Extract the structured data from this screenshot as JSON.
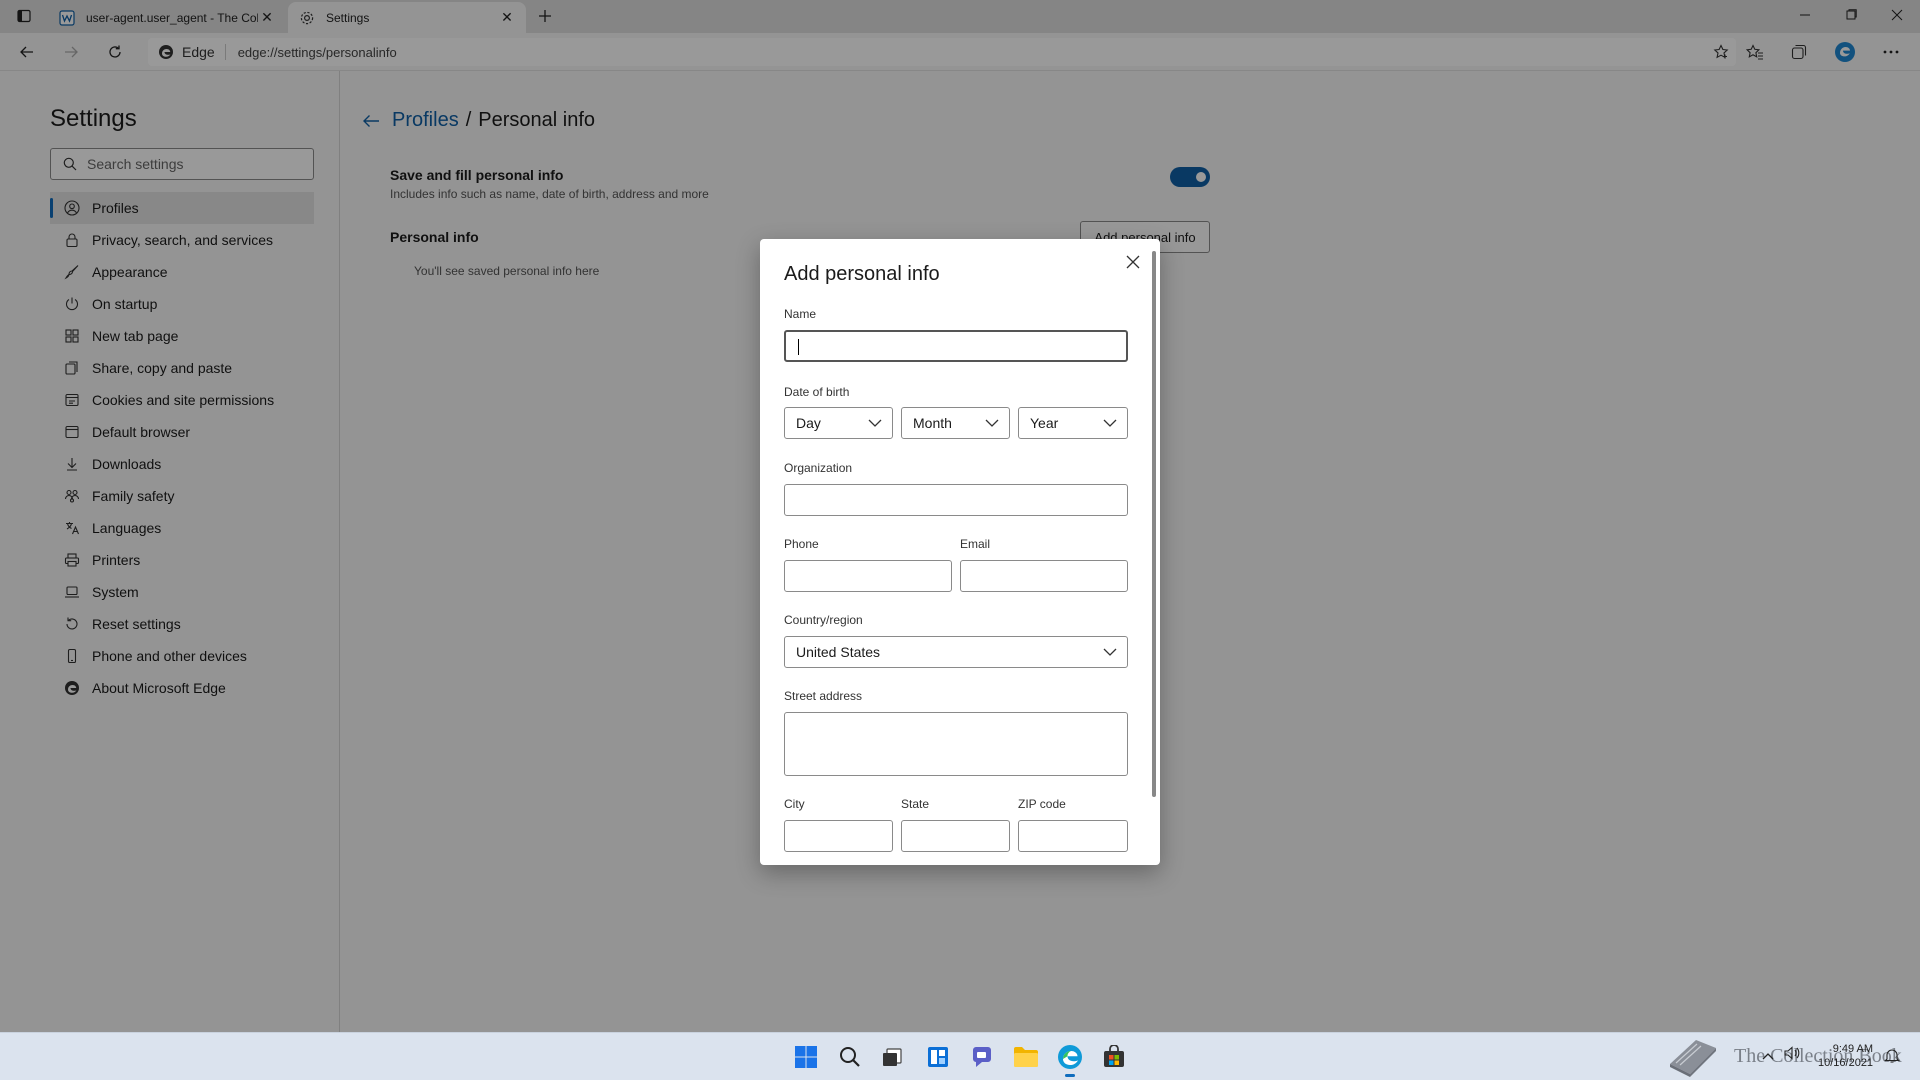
{
  "browser": {
    "tabs": [
      {
        "title": "user-agent.user_agent - The Coll",
        "icon": "document-favicon",
        "active": false
      },
      {
        "title": "Settings",
        "icon": "gear-icon",
        "active": true
      }
    ],
    "address": {
      "site_identity": "Edge",
      "url": "edge://settings/personalinfo"
    }
  },
  "sidebar": {
    "title": "Settings",
    "search_placeholder": "Search settings",
    "items": [
      {
        "label": "Profiles",
        "icon": "profile-icon",
        "selected": true
      },
      {
        "label": "Privacy, search, and services",
        "icon": "lock-icon"
      },
      {
        "label": "Appearance",
        "icon": "appearance-icon"
      },
      {
        "label": "On startup",
        "icon": "power-icon"
      },
      {
        "label": "New tab page",
        "icon": "grid-icon"
      },
      {
        "label": "Share, copy and paste",
        "icon": "share-icon"
      },
      {
        "label": "Cookies and site permissions",
        "icon": "cookie-icon"
      },
      {
        "label": "Default browser",
        "icon": "browser-icon"
      },
      {
        "label": "Downloads",
        "icon": "download-icon"
      },
      {
        "label": "Family safety",
        "icon": "family-icon"
      },
      {
        "label": "Languages",
        "icon": "language-icon"
      },
      {
        "label": "Printers",
        "icon": "printer-icon"
      },
      {
        "label": "System",
        "icon": "laptop-icon"
      },
      {
        "label": "Reset settings",
        "icon": "reset-icon"
      },
      {
        "label": "Phone and other devices",
        "icon": "phone-icon"
      },
      {
        "label": "About Microsoft Edge",
        "icon": "edge-icon"
      }
    ]
  },
  "content": {
    "breadcrumb_parent": "Profiles",
    "breadcrumb_sep": "/",
    "breadcrumb_current": "Personal info",
    "save_fill_title": "Save and fill personal info",
    "save_fill_desc": "Includes info such as name, date of birth, address and more",
    "save_fill_enabled": true,
    "personal_info_title": "Personal info",
    "empty_text": "You'll see saved personal info here",
    "add_button": "Add personal info"
  },
  "dialog": {
    "title": "Add personal info",
    "name_label": "Name",
    "name_value": "",
    "dob_label": "Date of birth",
    "day": "Day",
    "month": "Month",
    "year": "Year",
    "org_label": "Organization",
    "phone_label": "Phone",
    "email_label": "Email",
    "country_label": "Country/region",
    "country_value": "United States",
    "street_label": "Street address",
    "city_label": "City",
    "state_label": "State",
    "zip_label": "ZIP code"
  },
  "taskbar": {
    "time": "9:49 AM",
    "date": "10/16/2021",
    "watermark": "The Collection Book"
  },
  "colors": {
    "accent": "#0f5fa6",
    "taskbar": "#dbe3ee"
  }
}
